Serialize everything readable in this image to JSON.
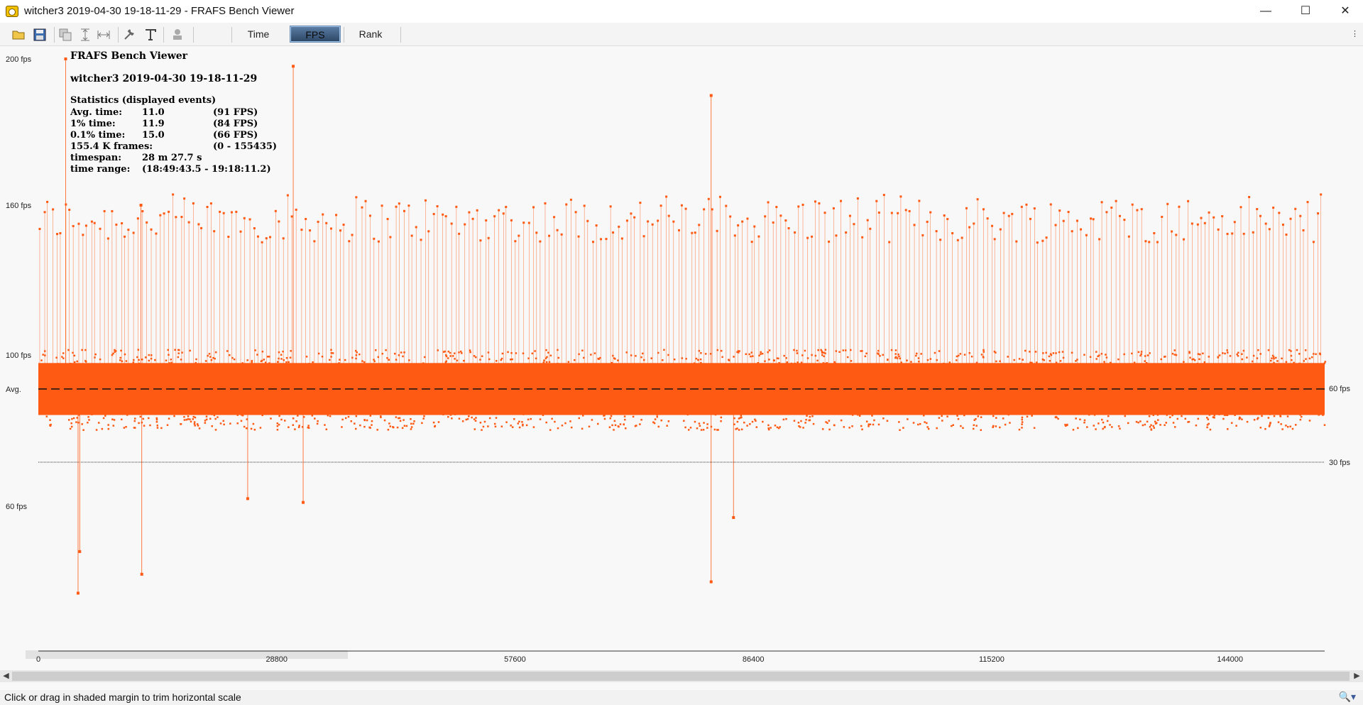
{
  "window": {
    "title": "witcher3 2019-04-30 19-18-11-29 - FRAFS Bench Viewer",
    "minimize": "—",
    "maximize": "☐",
    "close": "✕"
  },
  "toolbar": {
    "icons": [
      "open-folder-icon",
      "save-icon",
      "copy-icon",
      "fit-vertical-icon",
      "fit-horizontal-icon",
      "settings-wrench-icon",
      "text-icon",
      "stamp-icon"
    ],
    "tabs": [
      {
        "label": "Time",
        "active": false
      },
      {
        "label": "FPS",
        "active": true
      },
      {
        "label": "Rank",
        "active": false
      }
    ],
    "more": "⋮"
  },
  "info": {
    "app_name": "FRAFS Bench Viewer",
    "file_name": "witcher3 2019-04-30 19-18-11-29",
    "stats_title": "Statistics (displayed events)",
    "rows": [
      {
        "label": "Avg. time:",
        "value": "11.0",
        "extra": "(91 FPS)"
      },
      {
        "label": "1% time:",
        "value": "11.9",
        "extra": "(84 FPS)"
      },
      {
        "label": "0.1% time:",
        "value": "15.0",
        "extra": "(66 FPS)"
      },
      {
        "label": "155.4 K frames:",
        "value": "",
        "extra": "(0 - 155435)"
      },
      {
        "label": "timespan:",
        "value": "28 m 27.7 s",
        "extra": ""
      },
      {
        "label": "time range:",
        "value": "(18:49:43.5 - 19:18:11.2)",
        "extra": ""
      }
    ]
  },
  "chart_data": {
    "type": "scatter",
    "title": "",
    "xlabel": "",
    "ylabel": "",
    "xlim": [
      0,
      155435
    ],
    "x_ticks": [
      0,
      28800,
      57600,
      86400,
      115200,
      144000
    ],
    "x_tick_labels": [
      "0",
      "28800",
      "57600",
      "86400",
      "115200",
      "144000"
    ],
    "y_ticks": [
      {
        "value": 200,
        "label": "200 fps"
      },
      {
        "value": 160,
        "label": "160 fps"
      },
      {
        "value": 100,
        "label": "100 fps"
      },
      {
        "value": 60,
        "label": "60 fps"
      }
    ],
    "avg": {
      "label": "Avg.",
      "value": 91
    },
    "reference_lines": [
      {
        "value": 60,
        "label": "60 fps"
      },
      {
        "value": 30,
        "label": "30 fps"
      }
    ],
    "band": {
      "center": 91,
      "half_width": 8
    },
    "notable_points": [
      {
        "x": 3300,
        "y": 200
      },
      {
        "x": 5000,
        "y": 48
      },
      {
        "x": 12500,
        "y": 42
      },
      {
        "x": 30800,
        "y": 198
      },
      {
        "x": 81300,
        "y": 190
      },
      {
        "x": 81300,
        "y": 40
      },
      {
        "x": 84000,
        "y": 57
      },
      {
        "x": 12400,
        "y": 160
      },
      {
        "x": 4800,
        "y": 37
      },
      {
        "x": 25300,
        "y": 62
      },
      {
        "x": 32000,
        "y": 61
      }
    ],
    "series_color": "#ff5a14",
    "note": "155.4 K frames plotted as instantaneous FPS"
  },
  "status": {
    "text": "Click or drag in shaded margin to trim horizontal scale",
    "zoom": "🔍▾"
  },
  "colors": {
    "series": "#ff5a14",
    "background": "#f8f8f8",
    "reference_line": "#333333",
    "avg_line": "#111111"
  }
}
